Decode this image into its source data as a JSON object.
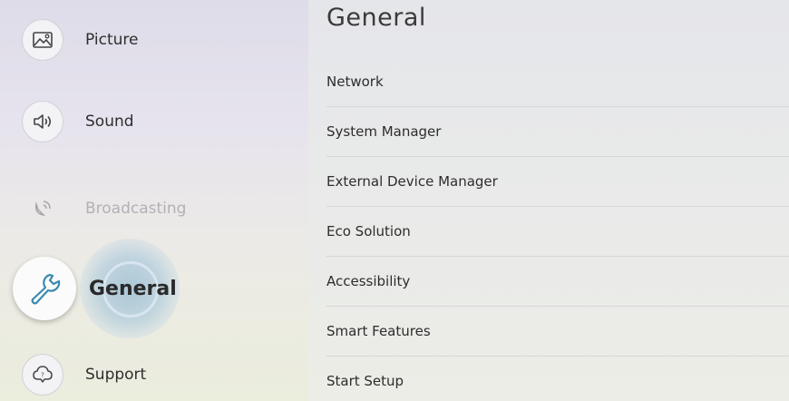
{
  "sidebar": {
    "items": [
      {
        "label": "Picture",
        "icon": "picture-icon"
      },
      {
        "label": "Sound",
        "icon": "sound-icon"
      },
      {
        "label": "Broadcasting",
        "icon": "broadcasting-icon",
        "state": "disabled"
      },
      {
        "label": "General",
        "icon": "wrench-icon",
        "state": "selected"
      },
      {
        "label": "Support",
        "icon": "support-icon"
      }
    ]
  },
  "panel": {
    "title": "General",
    "menu": [
      "Network",
      "System Manager",
      "External Device Manager",
      "Eco Solution",
      "Accessibility",
      "Smart Features",
      "Start Setup"
    ]
  },
  "colors": {
    "focus_highlight": "#7fb0d2",
    "sidebar_bg": "#e4e2ea",
    "panel_bg": "#e8e9e9",
    "text": "#2d2d2d",
    "disabled_text": "#b3b1b6"
  }
}
